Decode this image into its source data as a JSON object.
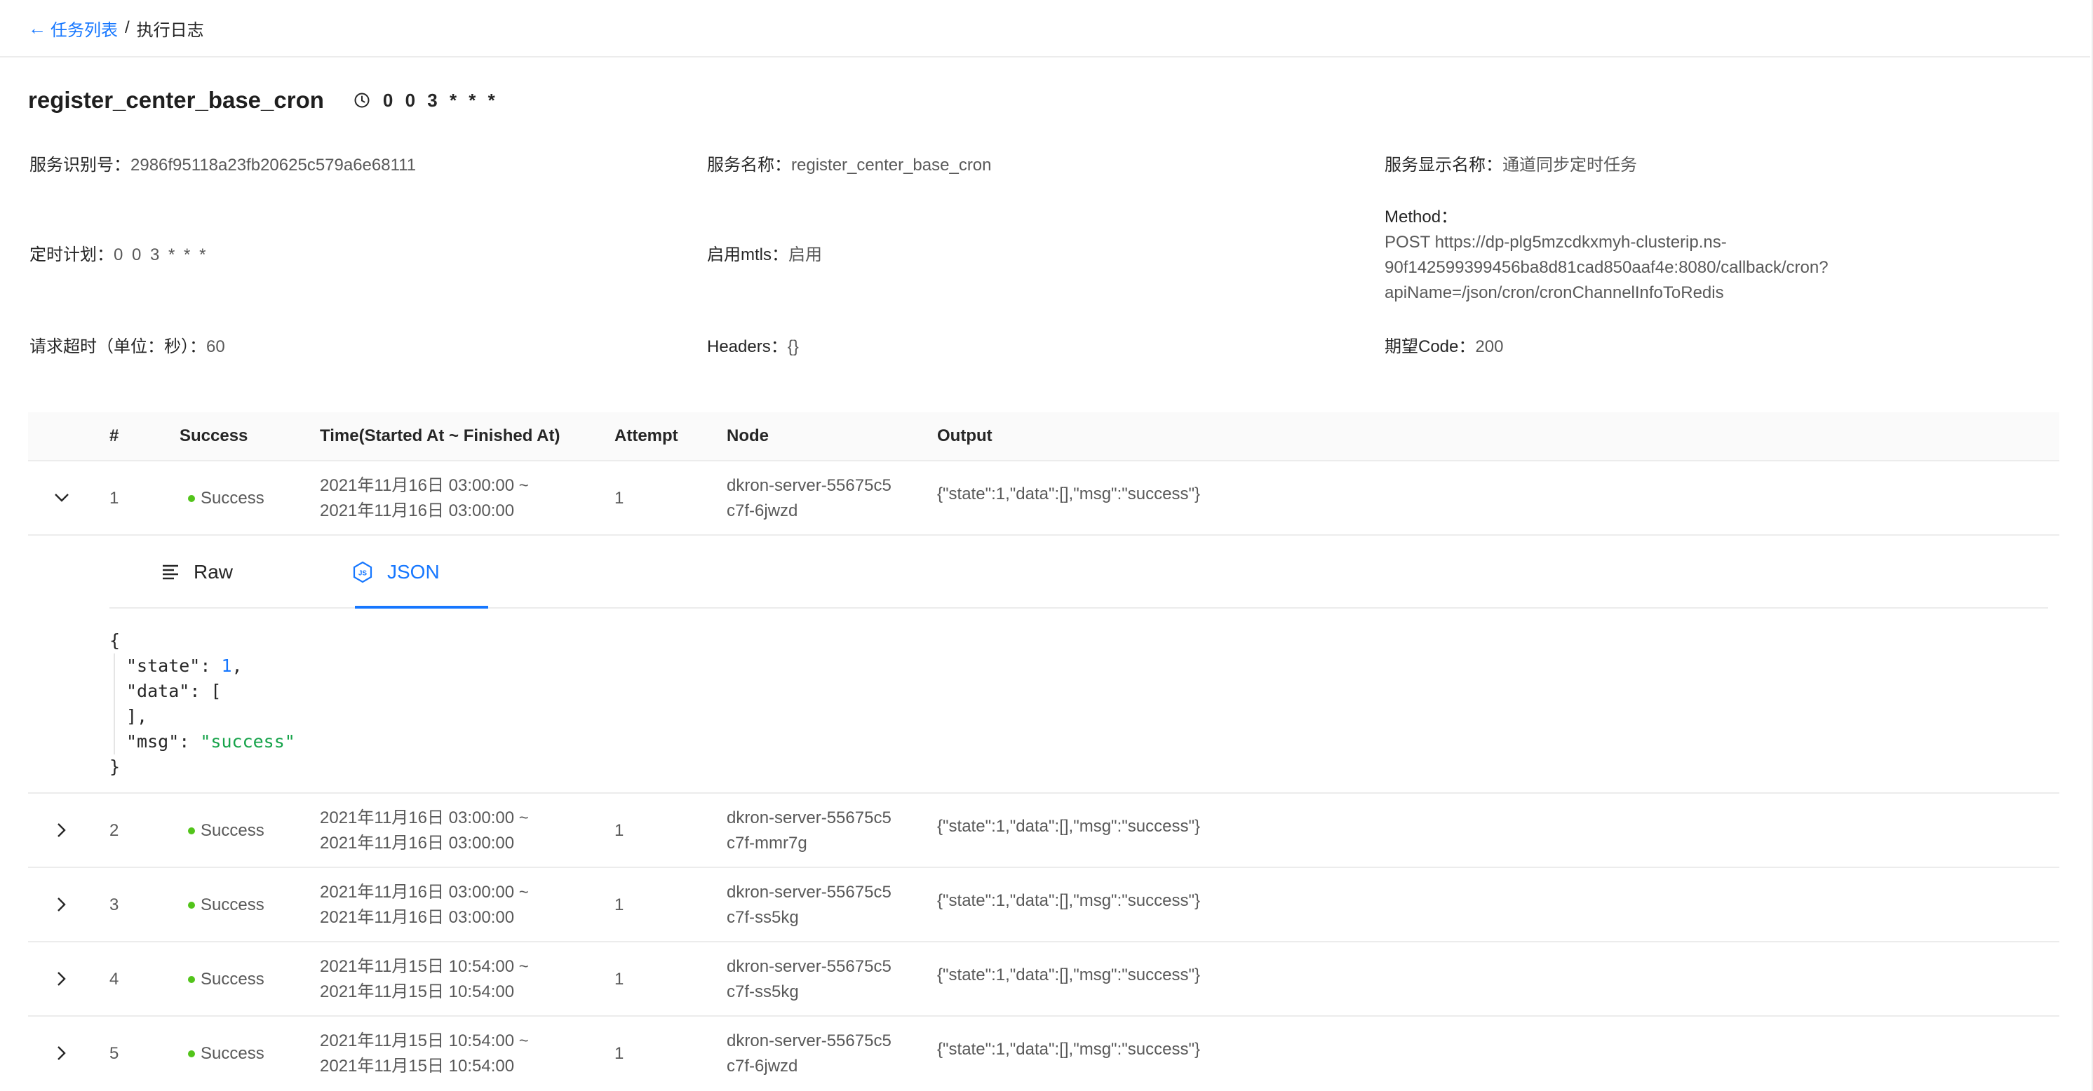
{
  "breadcrumb": {
    "back_arrow": "←",
    "back_label": "任务列表",
    "separator": "/",
    "current": "执行日志"
  },
  "job": {
    "title": "register_center_base_cron",
    "schedule": "0 0 3 * * *",
    "clock_icon": "clock-icon"
  },
  "info": {
    "service_id_label": "服务识别号：",
    "service_id_value": "2986f95118a23fb20625c579a6e68111",
    "service_name_label": "服务名称：",
    "service_name_value": "register_center_base_cron",
    "display_name_label": "服务显示名称：",
    "display_name_value": "通道同步定时任务",
    "cron_label": "定时计划：",
    "cron_value": "0 0 3 * * *",
    "mtls_label": "启用mtls：",
    "mtls_value": "启用",
    "method_label": "Method：",
    "method_line1": "POST https://dp-plg5mzcdkxmyh-clusterip.ns-",
    "method_line2": "90f142599399456ba8d81cad850aaf4e:8080/callback/cron?",
    "method_line3": "apiName=/json/cron/cronChannelInfoToRedis",
    "timeout_label": "请求超时（单位：秒）：",
    "timeout_value": "60",
    "headers_label": "Headers：",
    "headers_value": "{}",
    "code_label": "期望Code：",
    "code_value": "200"
  },
  "table": {
    "headers": {
      "index": "#",
      "success": "Success",
      "time": "Time(Started At ~ Finished At)",
      "attempt": "Attempt",
      "node": "Node",
      "output": "Output"
    },
    "rows": [
      {
        "index": "1",
        "status": "Success",
        "time_start": "2021年11月16日 03:00:00 ~",
        "time_end": "2021年11月16日 03:00:00",
        "attempt": "1",
        "node_line1": "dkron-server-55675c5",
        "node_line2": "c7f-6jwzd",
        "output": "{\"state\":1,\"data\":[],\"msg\":\"success\"}"
      },
      {
        "index": "2",
        "status": "Success",
        "time_start": "2021年11月16日 03:00:00 ~",
        "time_end": "2021年11月16日 03:00:00",
        "attempt": "1",
        "node_line1": "dkron-server-55675c5",
        "node_line2": "c7f-mmr7g",
        "output": "{\"state\":1,\"data\":[],\"msg\":\"success\"}"
      },
      {
        "index": "3",
        "status": "Success",
        "time_start": "2021年11月16日 03:00:00 ~",
        "time_end": "2021年11月16日 03:00:00",
        "attempt": "1",
        "node_line1": "dkron-server-55675c5",
        "node_line2": "c7f-ss5kg",
        "output": "{\"state\":1,\"data\":[],\"msg\":\"success\"}"
      },
      {
        "index": "4",
        "status": "Success",
        "time_start": "2021年11月15日 10:54:00 ~",
        "time_end": "2021年11月15日 10:54:00",
        "attempt": "1",
        "node_line1": "dkron-server-55675c5",
        "node_line2": "c7f-ss5kg",
        "output": "{\"state\":1,\"data\":[],\"msg\":\"success\"}"
      },
      {
        "index": "5",
        "status": "Success",
        "time_start": "2021年11月15日 10:54:00 ~",
        "time_end": "2021年11月15日 10:54:00",
        "attempt": "1",
        "node_line1": "dkron-server-55675c5",
        "node_line2": "c7f-6jwzd",
        "output": "{\"state\":1,\"data\":[],\"msg\":\"success\"}"
      }
    ]
  },
  "expanded": {
    "tabs": {
      "raw": "Raw",
      "json": "JSON"
    },
    "json": {
      "open_brace": "{",
      "state_key": "\"state\"",
      "state_colon": ": ",
      "state_value": "1",
      "state_comma": ",",
      "data_key": "\"data\"",
      "data_open": ": [",
      "data_close": "],",
      "msg_key": "\"msg\"",
      "msg_colon": ": ",
      "msg_value": "\"success\"",
      "close_brace": "}"
    }
  },
  "colors": {
    "accent": "#1677ff",
    "success": "#52c41a",
    "json_string": "#16a34a"
  }
}
